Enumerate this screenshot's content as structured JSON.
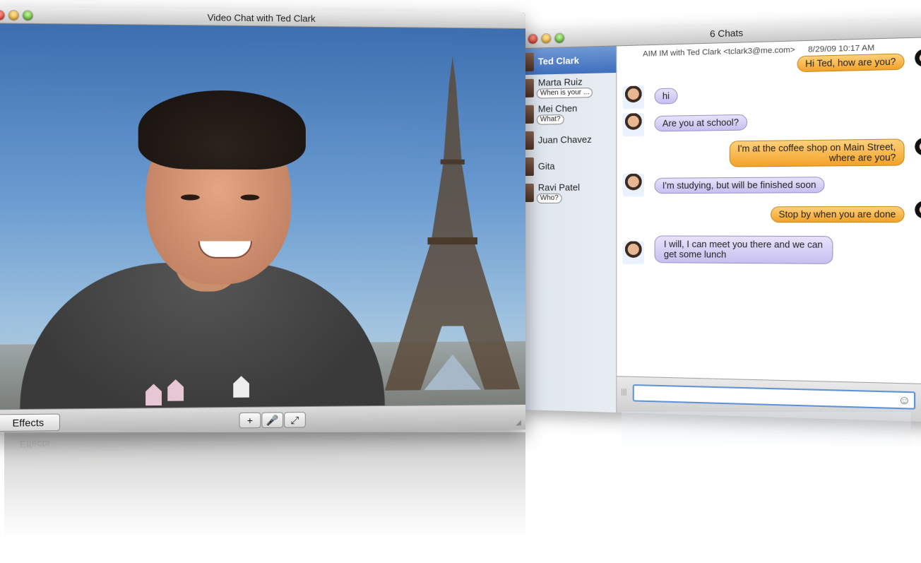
{
  "video_window": {
    "title": "Video Chat with Ted Clark",
    "effects_label": "Effects",
    "controls": [
      {
        "icon": "plus-icon",
        "glyph": "+"
      },
      {
        "icon": "mute-microphone-icon",
        "glyph": "🎤"
      },
      {
        "icon": "fullscreen-icon",
        "glyph": "⤢"
      }
    ]
  },
  "chat_window": {
    "title": "6 Chats",
    "header": {
      "account": "AIM IM with Ted Clark <tclark3@me.com>",
      "timestamp": "8/29/09 10:17 AM"
    },
    "buddies": [
      {
        "name": "Ted Clark",
        "selected": true,
        "preview": ""
      },
      {
        "name": "Marta Ruiz",
        "preview": "When is your ..."
      },
      {
        "name": "Mei Chen",
        "preview": "What?"
      },
      {
        "name": "Juan Chavez",
        "preview": ""
      },
      {
        "name": "Gita",
        "preview": ""
      },
      {
        "name": "Ravi Patel",
        "preview": "Who?"
      }
    ],
    "messages": [
      {
        "from": "me",
        "text": "Hi Ted, how are you?"
      },
      {
        "from": "them",
        "text": "hi"
      },
      {
        "from": "them",
        "text": "Are you at school?"
      },
      {
        "from": "me",
        "text": "I'm at the coffee shop on Main Street,\nwhere are you?"
      },
      {
        "from": "them",
        "text": "I'm studying, but will be finished soon"
      },
      {
        "from": "me",
        "text": "Stop by when you are done"
      },
      {
        "from": "them",
        "text": "I will, I can meet you there and we can\nget some lunch"
      }
    ],
    "input": {
      "value": "",
      "placeholder": ""
    }
  },
  "colors": {
    "outgoing_bubble": "#f2a22a",
    "incoming_bubble": "#c7bff0",
    "selection": "#3f6fbd"
  }
}
